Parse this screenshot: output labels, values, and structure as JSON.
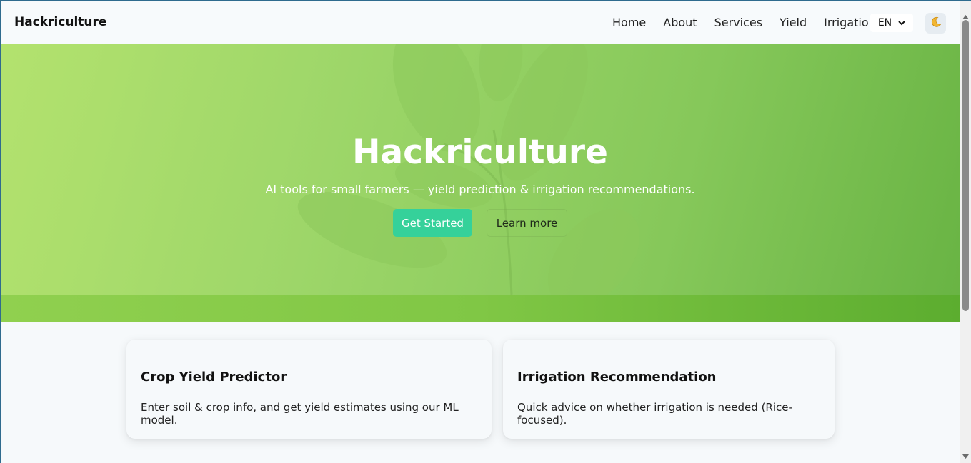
{
  "header": {
    "brand": "Hackriculture",
    "nav": {
      "home": "Home",
      "about": "About",
      "services": "Services",
      "yield": "Yield",
      "irrigation": "Irrigation"
    },
    "language": "EN",
    "theme_icon": "moon-icon"
  },
  "hero": {
    "title": "Hackriculture",
    "subtitle": "AI tools for small farmers — yield prediction & irrigation recommendations.",
    "primary_button": "Get Started",
    "secondary_button": "Learn more"
  },
  "cards": [
    {
      "title": "Crop Yield Predictor",
      "description": "Enter soil & crop info, and get yield estimates using our ML model."
    },
    {
      "title": "Irrigation Recommendation",
      "description": "Quick advice on whether irrigation is needed (Rice-focused)."
    }
  ],
  "colors": {
    "accent": "#35d19a",
    "hero_start": "#b3e26e",
    "hero_end": "#69b444"
  }
}
